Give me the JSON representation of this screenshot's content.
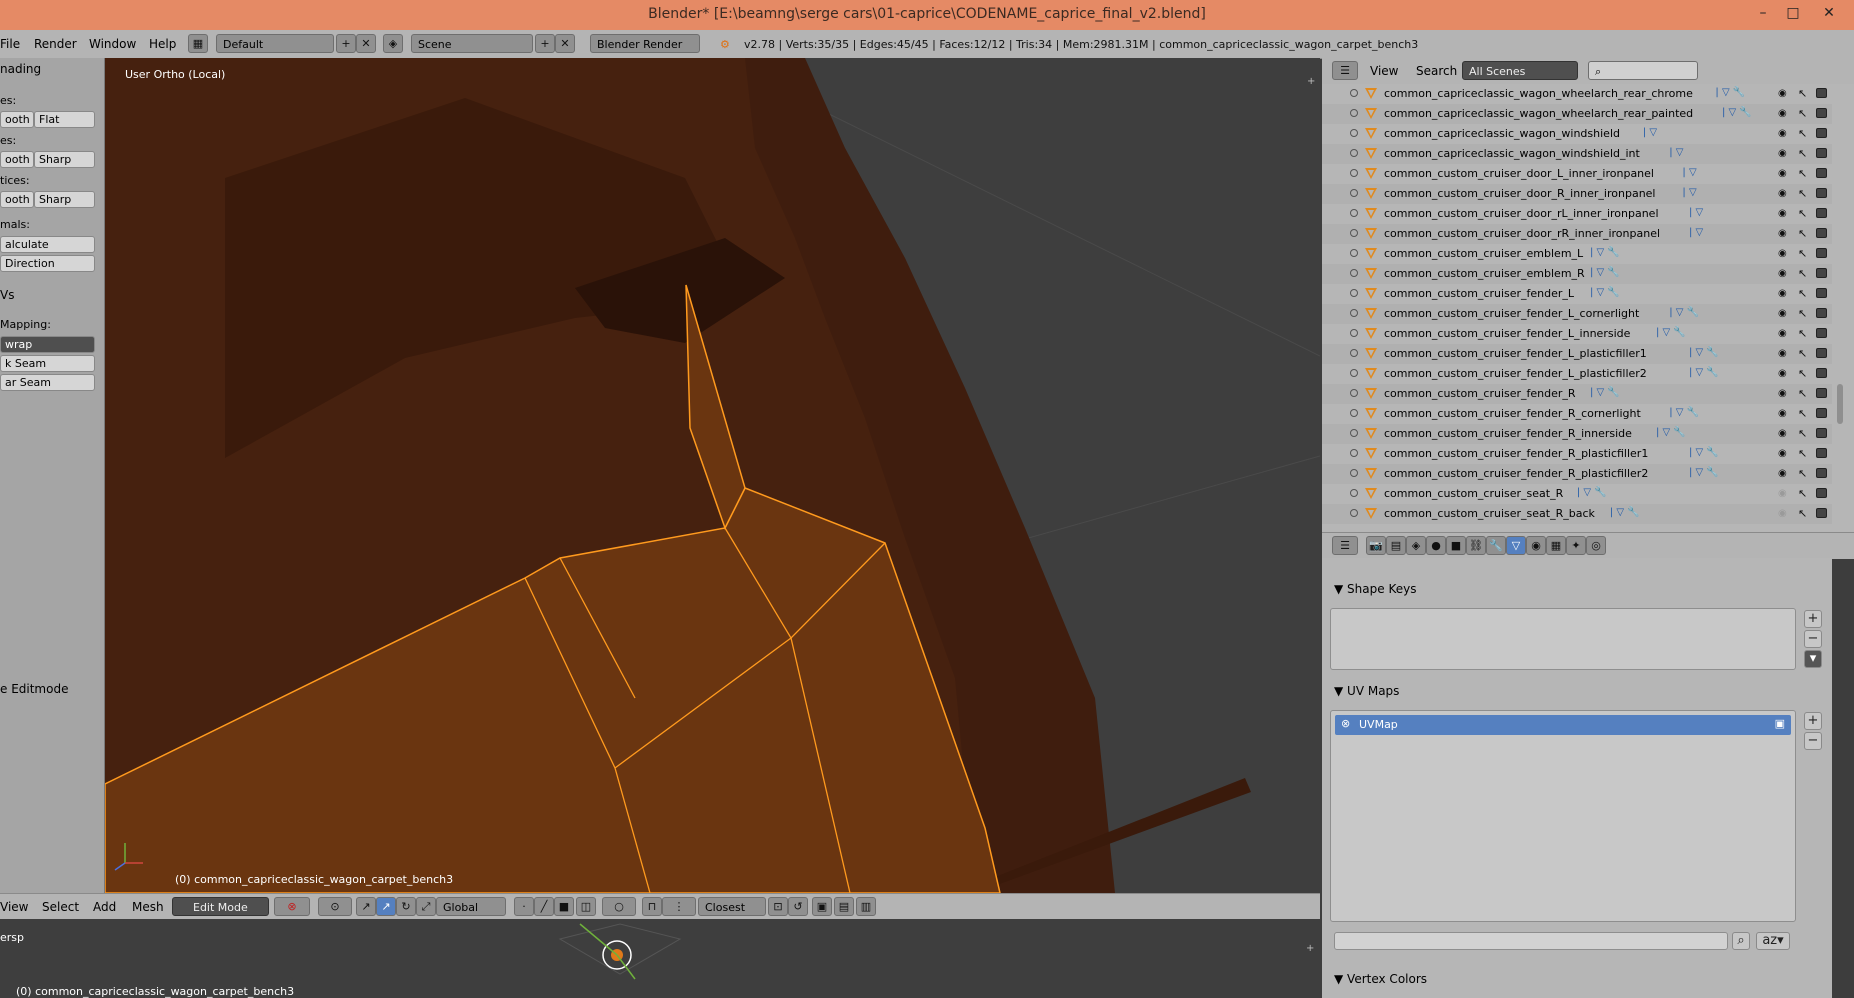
{
  "window": {
    "title": "Blender* [E:\\beamng\\serge cars\\01-caprice\\CODENAME_caprice_final_v2.blend]",
    "minimize": "–",
    "maximize": "□",
    "close": "✕"
  },
  "topbar": {
    "menus": [
      "File",
      "Render",
      "Window",
      "Help"
    ],
    "layout": "Default",
    "scene": "Scene",
    "engine": "Blender Render",
    "stats": "v2.78 | Verts:35/35 | Edges:45/45 | Faces:12/12 | Tris:34 | Mem:2981.31M | common_capriceclassic_wagon_carpet_bench3"
  },
  "toolshelf": {
    "shading_title": "nading",
    "faces_label": "es:",
    "edges_label": "es:",
    "vertices_label": "tices:",
    "smooth": "ooth",
    "flat": "Flat",
    "sharp": "Sharp",
    "normals_label": "mals:",
    "recalculate": "alculate",
    "flip_direction": "Direction",
    "uvs_title": "Vs",
    "mapping_label": "Mapping:",
    "unwrap": "wrap",
    "mark_seam": "k Seam",
    "clear_seam": "ar Seam",
    "editmode_toggle": "e Editmode"
  },
  "viewport": {
    "view_label": "User Ortho (Local)",
    "object_label": "(0) common_capriceclassic_wagon_carpet_bench3"
  },
  "view_header": {
    "menus": [
      "View",
      "Select",
      "Add",
      "Mesh"
    ],
    "mode": "Edit Mode",
    "orientation": "Global",
    "snap_target": "Closest"
  },
  "bottom_view": {
    "view_label": "ersp",
    "object_label": "(0) common_capriceclassic_wagon_carpet_bench3"
  },
  "outliner": {
    "menus": [
      "View",
      "Search"
    ],
    "filter": "All Scenes",
    "items": [
      {
        "name": "common_capriceclassic_wagon_wheelarch_rear_chrome",
        "mod": true,
        "visible": true
      },
      {
        "name": "common_capriceclassic_wagon_wheelarch_rear_painted",
        "mod": true,
        "visible": true
      },
      {
        "name": "common_capriceclassic_wagon_windshield",
        "mod": false,
        "visible": true
      },
      {
        "name": "common_capriceclassic_wagon_windshield_int",
        "mod": false,
        "visible": true
      },
      {
        "name": "common_custom_cruiser_door_L_inner_ironpanel",
        "mod": false,
        "visible": true
      },
      {
        "name": "common_custom_cruiser_door_R_inner_ironpanel",
        "mod": false,
        "visible": true
      },
      {
        "name": "common_custom_cruiser_door_rL_inner_ironpanel",
        "mod": false,
        "visible": true
      },
      {
        "name": "common_custom_cruiser_door_rR_inner_ironpanel",
        "mod": false,
        "visible": true
      },
      {
        "name": "common_custom_cruiser_emblem_L",
        "mod": true,
        "visible": true
      },
      {
        "name": "common_custom_cruiser_emblem_R",
        "mod": true,
        "visible": true
      },
      {
        "name": "common_custom_cruiser_fender_L",
        "mod": true,
        "visible": true
      },
      {
        "name": "common_custom_cruiser_fender_L_cornerlight",
        "mod": true,
        "visible": true
      },
      {
        "name": "common_custom_cruiser_fender_L_innerside",
        "mod": true,
        "visible": true
      },
      {
        "name": "common_custom_cruiser_fender_L_plasticfiller1",
        "mod": true,
        "visible": true
      },
      {
        "name": "common_custom_cruiser_fender_L_plasticfiller2",
        "mod": true,
        "visible": true
      },
      {
        "name": "common_custom_cruiser_fender_R",
        "mod": true,
        "visible": true
      },
      {
        "name": "common_custom_cruiser_fender_R_cornerlight",
        "mod": true,
        "visible": true
      },
      {
        "name": "common_custom_cruiser_fender_R_innerside",
        "mod": true,
        "visible": true
      },
      {
        "name": "common_custom_cruiser_fender_R_plasticfiller1",
        "mod": true,
        "visible": true
      },
      {
        "name": "common_custom_cruiser_fender_R_plasticfiller2",
        "mod": true,
        "visible": true
      },
      {
        "name": "common_custom_cruiser_seat_R",
        "mod": true,
        "visible": false
      },
      {
        "name": "common_custom_cruiser_seat_R_back",
        "mod": true,
        "visible": false
      }
    ]
  },
  "properties": {
    "shape_keys_title": "Shape Keys",
    "uv_maps_title": "UV Maps",
    "uv_map_name": "UVMap",
    "vertex_colors_title": "Vertex Colors"
  },
  "colors": {
    "title_bar": "#e58a65",
    "header": "#b4b4b4",
    "selection_face": "#ff8c00",
    "uv_selected": "#5580c0"
  }
}
